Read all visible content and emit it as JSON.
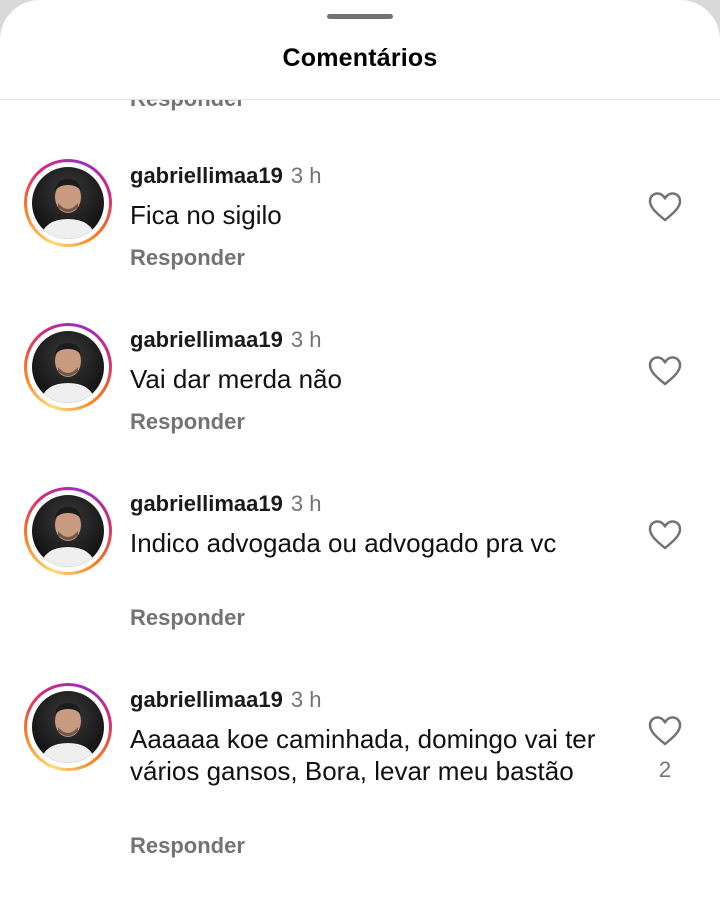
{
  "header": {
    "title": "Comentários"
  },
  "cut_off_reply_label": "Responder",
  "comments": [
    {
      "username": "gabriellimaa19",
      "time": "3 h",
      "text": "Fica no sigilo",
      "reply_label": "Responder",
      "like_icon": "heart-outline-icon"
    },
    {
      "username": "gabriellimaa19",
      "time": "3 h",
      "text": "Vai dar merda não",
      "reply_label": "Responder",
      "like_icon": "heart-outline-icon"
    },
    {
      "username": "gabriellimaa19",
      "time": "3 h",
      "text": "Indico advogada ou advogado pra vc",
      "reply_label": "Responder",
      "like_icon": "heart-outline-icon"
    },
    {
      "username": "gabriellimaa19",
      "time": "3 h",
      "text": "Aaaaaa koe caminhada, domingo vai ter vários gansos, Bora, levar meu bastão",
      "reply_label": "Responder",
      "like_icon": "heart-outline-icon",
      "like_count": "2"
    }
  ],
  "colors": {
    "secondary_text": "#737373",
    "ring_gradient": [
      "#feda75",
      "#fa7e1e",
      "#d62976",
      "#962fbf"
    ]
  }
}
